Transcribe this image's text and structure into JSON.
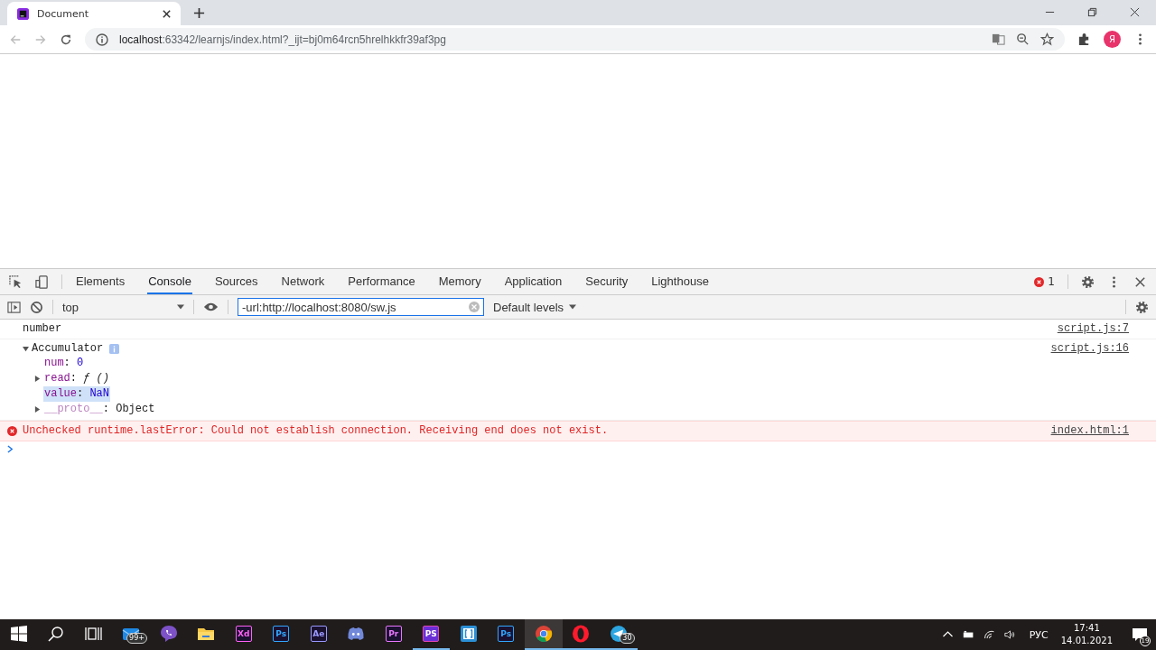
{
  "browser": {
    "tab": {
      "title": "Document",
      "selected": true
    },
    "url_host": "localhost",
    "url_path": ":63342/learnjs/index.html?_ijt=bj0m64rcn5hrelhkkfr39af3pg",
    "profile_initial": "Я"
  },
  "devtools": {
    "tabs": [
      {
        "label": "Elements",
        "selected": false
      },
      {
        "label": "Console",
        "selected": true
      },
      {
        "label": "Sources",
        "selected": false
      },
      {
        "label": "Network",
        "selected": false
      },
      {
        "label": "Performance",
        "selected": false
      },
      {
        "label": "Memory",
        "selected": false
      },
      {
        "label": "Application",
        "selected": false
      },
      {
        "label": "Security",
        "selected": false
      },
      {
        "label": "Lighthouse",
        "selected": false
      }
    ],
    "error_count": "1",
    "toolbar": {
      "context": "top",
      "filter": "-url:http://localhost:8080/sw.js",
      "levels": "Default levels"
    },
    "messages": [
      {
        "kind": "log",
        "text": "number",
        "source": "script.js:7"
      },
      {
        "kind": "object",
        "text": "Accumulator",
        "source": "script.js:16",
        "expanded": true,
        "properties": [
          {
            "key": "num",
            "separator": ":",
            "value": "0",
            "kind": "number",
            "expandable": false,
            "selected": false,
            "dimmed": false
          },
          {
            "key": "read",
            "separator": ":",
            "value": "ƒ ()",
            "kind": "function",
            "expandable": true,
            "selected": false,
            "dimmed": false
          },
          {
            "key": "value",
            "separator": ":",
            "value": "NaN",
            "kind": "number",
            "expandable": false,
            "selected": true,
            "dimmed": false
          },
          {
            "key": "__proto__",
            "separator": ":",
            "value": "Object",
            "kind": "object",
            "expandable": true,
            "selected": false,
            "dimmed": true
          }
        ]
      },
      {
        "kind": "error",
        "text": "Unchecked runtime.lastError: Could not establish connection. Receiving end does not exist.",
        "source": "index.html:1"
      }
    ]
  },
  "taskbar": {
    "items": [
      {
        "kind": "windows",
        "running": false,
        "active": false
      },
      {
        "kind": "search",
        "running": false,
        "active": false
      },
      {
        "kind": "taskview",
        "running": false,
        "active": false
      },
      {
        "kind": "mail",
        "badge": "99+",
        "running": false,
        "active": false
      },
      {
        "kind": "viber",
        "running": false,
        "active": false
      },
      {
        "kind": "folder",
        "running": false,
        "active": false
      },
      {
        "kind": "letters",
        "label": "Xd",
        "color": "#ff61f6",
        "running": false,
        "active": false
      },
      {
        "kind": "letters",
        "label": "Ps",
        "color": "#31a8ff",
        "running": false,
        "active": false
      },
      {
        "kind": "letters",
        "label": "Ae",
        "color": "#9999ff",
        "running": false,
        "active": false
      },
      {
        "kind": "discord",
        "running": false,
        "active": false
      },
      {
        "kind": "letters",
        "label": "Pr",
        "color": "#ea77ff",
        "running": false,
        "active": false
      },
      {
        "kind": "phpstorm",
        "label": "PS",
        "running": true,
        "active": false
      },
      {
        "kind": "bracket",
        "running": false,
        "active": false
      },
      {
        "kind": "letters",
        "label": "Ps",
        "color": "#31a8ff",
        "running": false,
        "active": false
      },
      {
        "kind": "chrome",
        "running": true,
        "active": true
      },
      {
        "kind": "opera",
        "running": true,
        "active": false
      },
      {
        "kind": "telegram",
        "badge": "30",
        "running": true,
        "active": false
      }
    ],
    "language": "РУС",
    "time": "17:41",
    "date": "14.01.2021",
    "notifications": "19"
  }
}
